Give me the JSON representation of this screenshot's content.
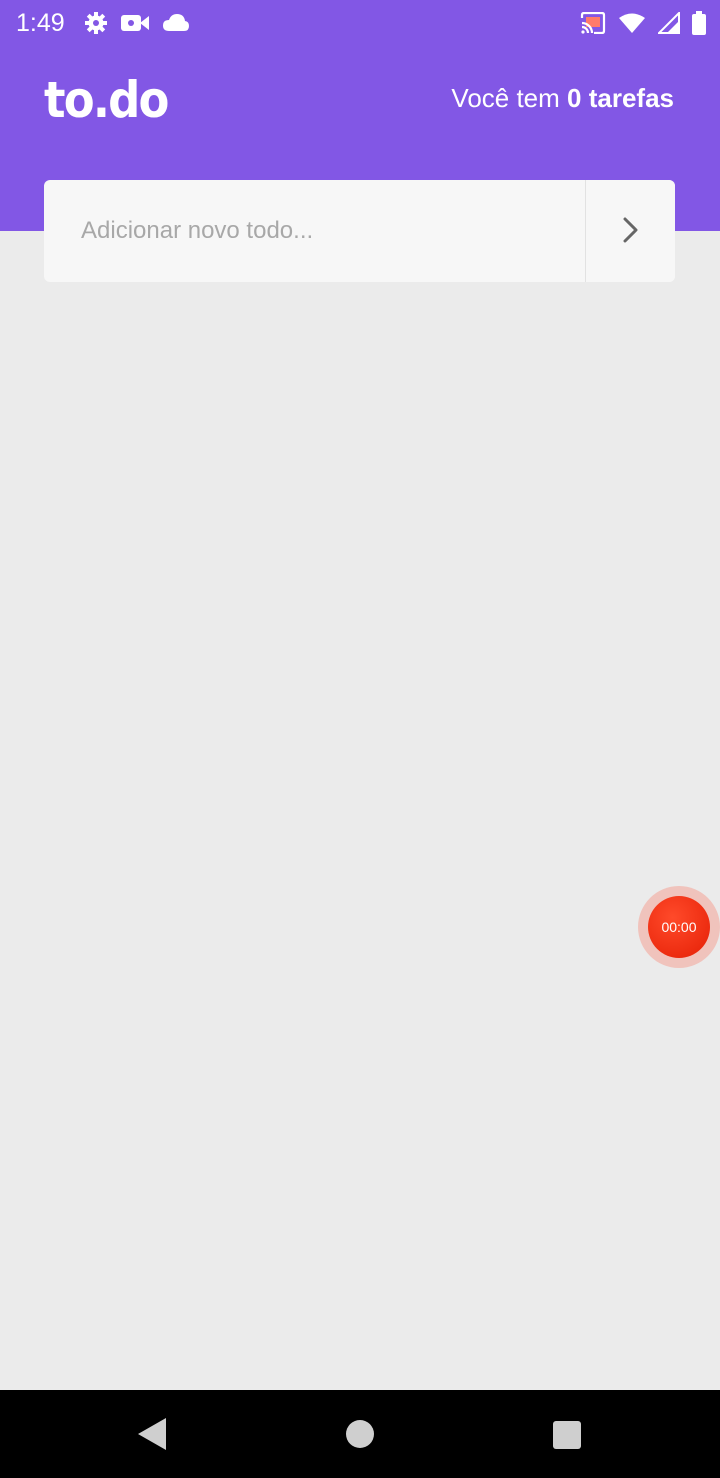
{
  "status_bar": {
    "time": "1:49",
    "left_icons": [
      "gear-icon",
      "video-camera-icon",
      "cloud-icon"
    ],
    "right_icons": [
      "cast-icon",
      "wifi-icon",
      "signal-icon",
      "battery-icon"
    ]
  },
  "header": {
    "logo": "to.do",
    "task_count_prefix": "Você tem ",
    "task_count_value": "0 tarefas"
  },
  "new_todo": {
    "placeholder": "Adicionar novo todo...",
    "value": ""
  },
  "recorder": {
    "timer": "00:00"
  },
  "colors": {
    "brand": "#8257e5",
    "background": "#ebebeb",
    "record": "#f5300f"
  },
  "nav_bar": {
    "buttons": [
      "back-icon",
      "home-icon",
      "recents-icon"
    ]
  }
}
